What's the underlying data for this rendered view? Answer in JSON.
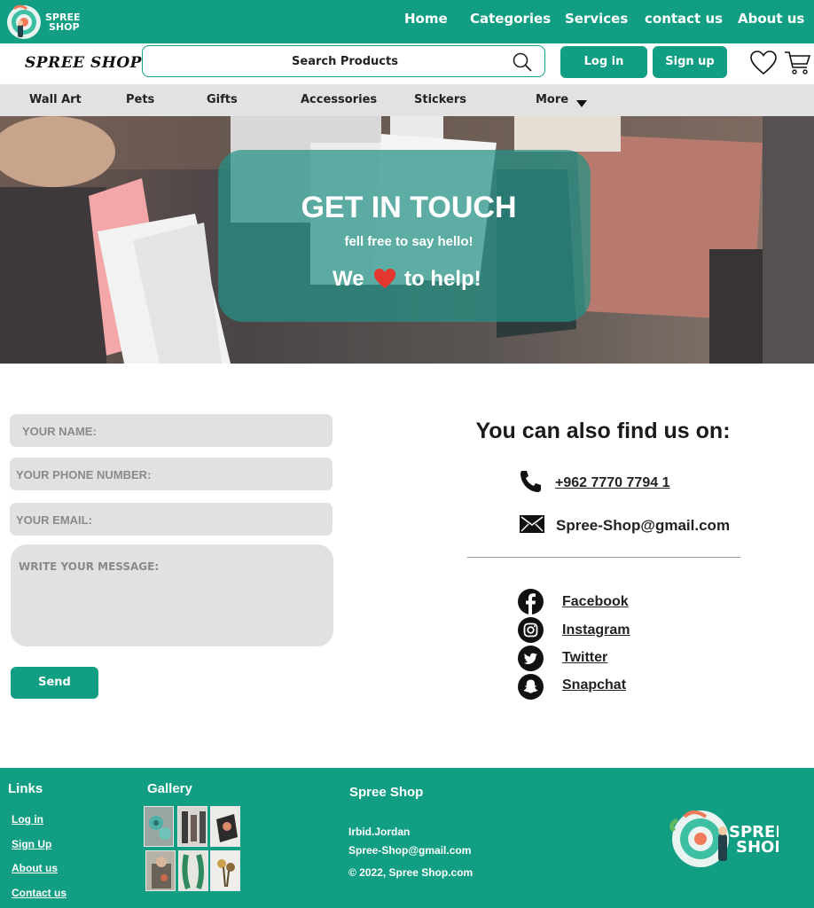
{
  "brand": {
    "logo_text_line1": "SPREE",
    "logo_text_line2": "SHOP",
    "wordmark": "SPREE SHOP"
  },
  "topnav": {
    "items": [
      "Home",
      "Categories",
      "Services",
      "contact us",
      "About us"
    ]
  },
  "search": {
    "placeholder": "Search Products"
  },
  "auth": {
    "login_label": "Log in",
    "signup_label": "Sign up"
  },
  "icons": {
    "search": "search-icon",
    "wishlist": "heart-icon",
    "cart": "cart-icon",
    "dropdown": "caret-down-icon",
    "phone": "phone-icon",
    "email": "envelope-icon",
    "facebook": "facebook-icon",
    "instagram": "instagram-icon",
    "twitter": "twitter-icon",
    "snapchat": "snapchat-icon"
  },
  "categories": {
    "items": [
      "Wall Art",
      "Pets",
      "Gifts",
      "Accessories",
      "Stickers"
    ],
    "more_label": "More"
  },
  "hero": {
    "title": "GET IN TOUCH",
    "subtitle": "fell free to say hello!",
    "tagline_before": "We",
    "tagline_after": "to help!"
  },
  "form": {
    "name_placeholder": "YOUR NAME:",
    "phone_placeholder": "YOUR PHONE NUMBER:",
    "email_placeholder": "YOUR EMAIL:",
    "message_placeholder": "WRITE YOUR MESSAGE:",
    "send_label": "Send"
  },
  "contact": {
    "heading": "You can also find us on:",
    "phone": "+962 7770 7794 1",
    "email": "Spree-Shop@gmail.com",
    "socials": [
      "Facebook",
      "Instagram",
      "Twitter",
      "Snapchat"
    ]
  },
  "footer": {
    "links_heading": "Links",
    "links": [
      "Log in",
      "Sign Up",
      "About us",
      "Contact us"
    ],
    "gallery_heading": "Gallery",
    "shop_heading": "Spree Shop",
    "location": "Irbid.Jordan",
    "email": "Spree-Shop@gmail.com",
    "copyright": "© 2022, Spree Shop.com"
  },
  "colors": {
    "brand_teal": "#129e83",
    "hero_panel": "#249187",
    "heart_red": "#e2362f",
    "field_gray": "#e1e1e1",
    "category_bar": "#e2e2e2"
  }
}
